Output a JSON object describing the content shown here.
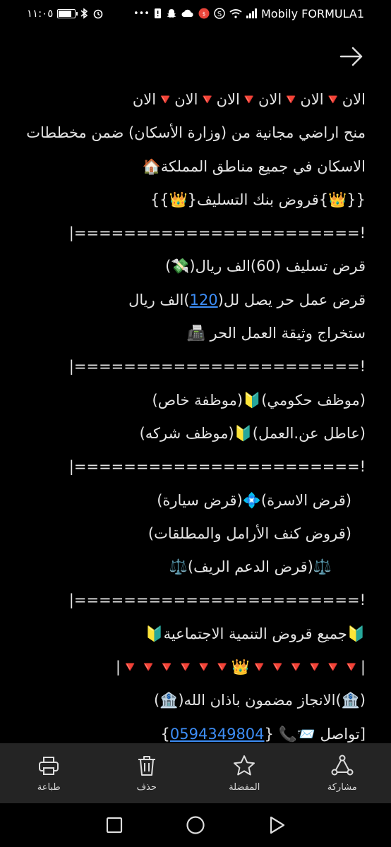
{
  "status_bar": {
    "time": "١١:٠٥",
    "carrier": "Mobily FORMULA1",
    "network": "4G",
    "battery_level": 0.9
  },
  "message": {
    "lines": [
      "الان🔻الان🔻الان🔻الان🔻الان🔻الان",
      "منح اراضي مجانية من (وزارة الأسكان) ضمن مخططات",
      "الاسكان في جميع  مناطق المملكة🏠",
      "{{👑}قروض بنك التسليف{👑}}",
      "!=======================|",
      "قرض تسليف (60)الف ريال(💸)",
      "!=======================|",
      "(موظف حكومي)🔰(موظفة خاص)",
      "(عاطل عن.العمل)🔰(موظف شركه)",
      "!=======================|",
      "(قرض الاسرة)💠(قرض سيارة)",
      "(قروض كنف الأرامل والمطلقات)",
      "⚖️(قرض الدعم الريف)⚖️",
      "!=======================|",
      "🔰جميع قروض التنمية الاجتماعية🔰",
      "|🔻🔻🔻🔻🔻🔻👑🔻🔻🔻🔻🔻🔻|",
      "(🏦)الانجاز مضمون باذان الله(🏦)"
    ],
    "loan_line_prefix": "قرض عمل حر يصل لل(",
    "loan_amount_link": "120",
    "loan_line_suffix": ")الف ريال",
    "document_line": "ستخراج وثيقة العمل الحر 📠",
    "contact_prefix": "[تواصل 📨📞 {",
    "phone_link": "0594349804",
    "contact_suffix": "}"
  },
  "action_bar": {
    "share": "مشاركة",
    "favorite": "المفضلة",
    "delete": "حذف",
    "print": "طباعة"
  },
  "colors": {
    "link": "#3d8df5",
    "bar_bg": "#242424",
    "text": "#e4e4e4"
  }
}
